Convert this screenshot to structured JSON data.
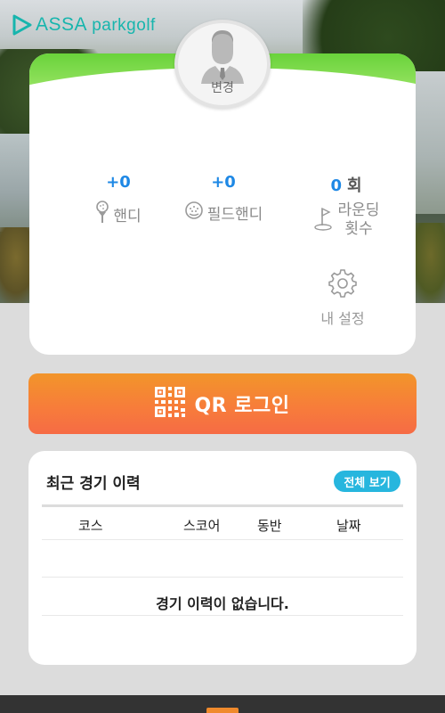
{
  "brand": {
    "primary": "ASSA",
    "secondary": "parkgolf",
    "color": "#17b5ad"
  },
  "profile": {
    "change_label": "변경"
  },
  "stats": {
    "handicap": {
      "value": "+0",
      "label": "핸디"
    },
    "field_handicap": {
      "value": "+0",
      "label": "필드핸디"
    },
    "rounds": {
      "value": "0",
      "unit": "회",
      "label_line1": "라운딩",
      "label_line2": "횟수"
    }
  },
  "settings": {
    "label": "내 설정"
  },
  "qr_login": {
    "label": "QR 로그인"
  },
  "history": {
    "title": "최근 경기 이력",
    "view_all": "전체 보기",
    "columns": [
      "코스",
      "스코어",
      "동반",
      "날짜"
    ],
    "empty_message": "경기 이력이 없습니다."
  },
  "colors": {
    "accent_orange": "#f77d3a",
    "accent_blue": "#1e88e5",
    "view_all_bg": "#27b6de",
    "green_band": "#69d33a"
  }
}
